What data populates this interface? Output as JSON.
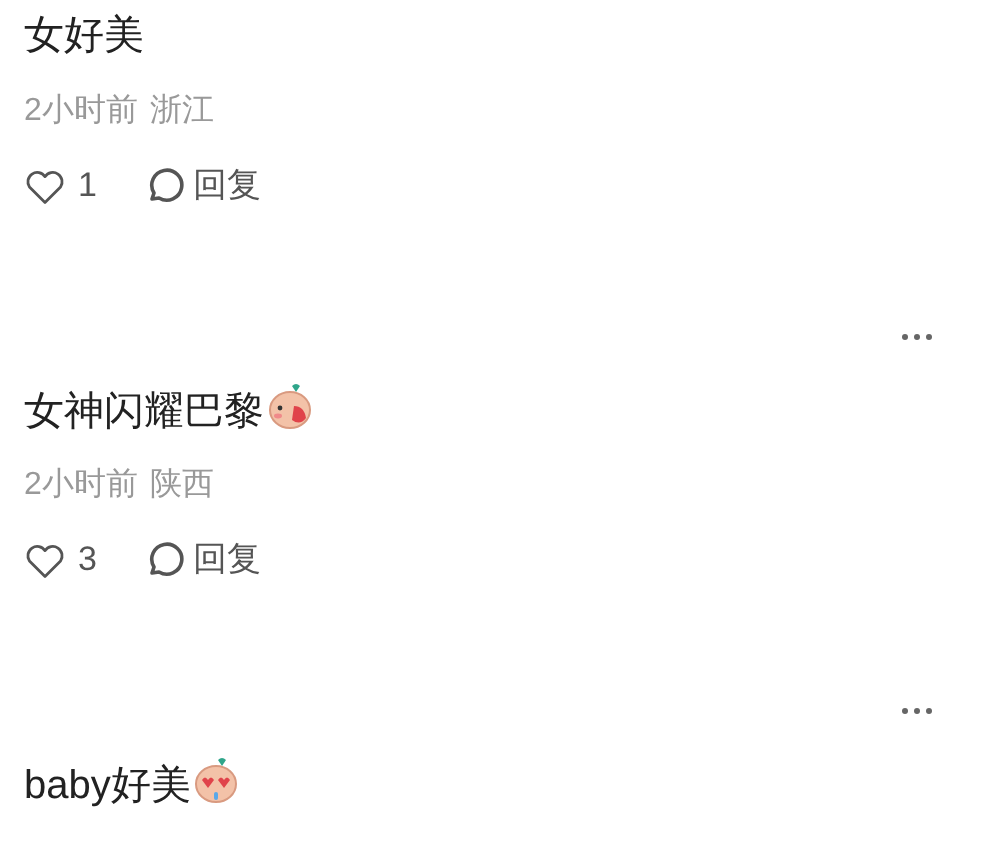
{
  "comments": [
    {
      "text": "女好美",
      "time": "2小时前",
      "region": "浙江",
      "likes": "1",
      "reply": "回复"
    },
    {
      "has_menu": true,
      "text": "女神闪耀巴黎",
      "sticker": {
        "kind": "blush"
      },
      "time": "2小时前",
      "region": "陕西",
      "likes": "3",
      "reply": "回复"
    },
    {
      "has_menu": true,
      "text": "baby好美",
      "sticker": {
        "kind": "heart_eyes"
      }
    }
  ]
}
